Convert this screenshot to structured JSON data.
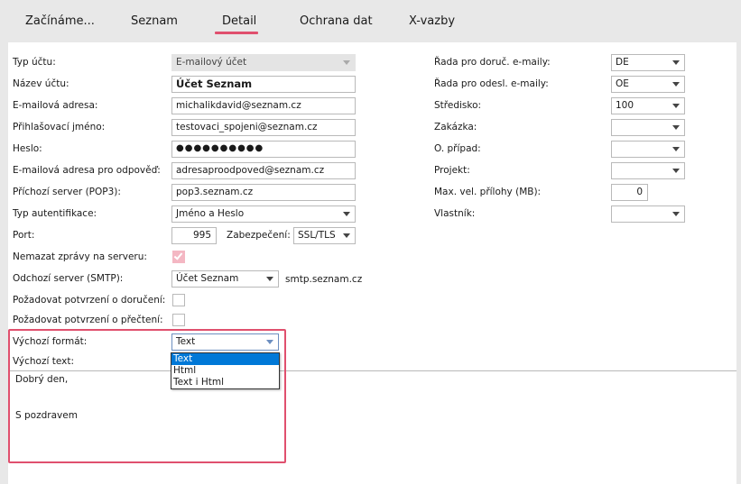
{
  "tabs": [
    {
      "label": "Začínáme..."
    },
    {
      "label": "Seznam"
    },
    {
      "label": "Detail"
    },
    {
      "label": "Ochrana dat"
    },
    {
      "label": "X-vazby"
    }
  ],
  "left": {
    "typ_uctu": {
      "label": "Typ účtu:",
      "value": "E-mailový účet"
    },
    "nazev_uctu": {
      "label": "Název účtu:",
      "value": "Účet Seznam"
    },
    "email": {
      "label": "E-mailová adresa:",
      "value": "michalikdavid@seznam.cz"
    },
    "login": {
      "label": "Přihlašovací jméno:",
      "value": "testovaci_spojeni@seznam.cz"
    },
    "heslo": {
      "label": "Heslo:",
      "value": "●●●●●●●●●●"
    },
    "reply_email": {
      "label": "E-mailová adresa pro odpověď:",
      "value": "adresaproodpoved@seznam.cz"
    },
    "incoming": {
      "label": "Příchozí server (POP3):",
      "value": "pop3.seznam.cz"
    },
    "auth": {
      "label": "Typ autentifikace:",
      "value": "Jméno a Heslo"
    },
    "port": {
      "label": "Port:",
      "value": "995"
    },
    "security": {
      "label": "Zabezpečení:",
      "value": "SSL/TLS"
    },
    "keep_on_server": {
      "label": "Nemazat zprávy na serveru:",
      "checked": true
    },
    "outgoing": {
      "label": "Odchozí server (SMTP):",
      "value": "Účet Seznam",
      "server": "smtp.seznam.cz"
    },
    "delivery_receipt": {
      "label": "Požadovat potvrzení o doručení:",
      "checked": false
    },
    "read_receipt": {
      "label": "Požadovat potvrzení o přečtení:",
      "checked": false
    },
    "format": {
      "label": "Výchozí formát:",
      "value": "Text",
      "options": [
        "Text",
        "Html",
        "Text i Html"
      ]
    },
    "default_text": {
      "label": "Výchozí text:",
      "lines": [
        "Dobrý den,",
        "S pozdravem"
      ]
    }
  },
  "right": {
    "rada_doruc": {
      "label": "Řada pro doruč. e-maily:",
      "value": "DE"
    },
    "rada_odesl": {
      "label": "Řada pro odesl. e-maily:",
      "value": "OE"
    },
    "stredisko": {
      "label": "Středisko:",
      "value": "100"
    },
    "zakazka": {
      "label": "Zakázka:",
      "value": ""
    },
    "pripad": {
      "label": "O. případ:",
      "value": ""
    },
    "projekt": {
      "label": "Projekt:",
      "value": ""
    },
    "max_priloha": {
      "label": "Max. vel. přílohy (MB):",
      "value": "0"
    },
    "vlastnik": {
      "label": "Vlastník:",
      "value": ""
    }
  },
  "colors": {
    "accent": "#e0506e",
    "selection": "#0078d7",
    "checkbox_on": "#f4b7c3"
  }
}
